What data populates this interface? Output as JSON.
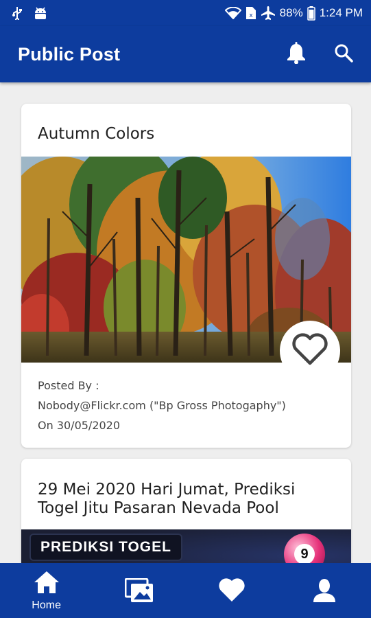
{
  "status_bar": {
    "battery": "88%",
    "time": "1:24 PM",
    "icons": [
      "usb-icon",
      "android-icon",
      "wifi-icon",
      "sim-icon",
      "airplane-icon",
      "battery-icon"
    ]
  },
  "app_bar": {
    "title": "Public Post",
    "actions": [
      "bell-icon",
      "search-icon"
    ]
  },
  "posts": [
    {
      "title": "Autumn Colors",
      "posted_by_label": "Posted By :",
      "author": "Nobody@Flickr.com (\"Bp Gross Photogaphy\")",
      "date_line": "On 30/05/2020"
    },
    {
      "title": "29 Mei 2020 Hari Jumat, Prediksi Togel Jitu Pasaran Nevada Pool",
      "image_banner": "PREDIKSI TOGEL",
      "ball_number": "9"
    }
  ],
  "bottom_nav": {
    "items": [
      {
        "label": "Home",
        "icon": "home-icon",
        "active": true
      },
      {
        "icon": "gallery-icon"
      },
      {
        "icon": "heart-icon"
      },
      {
        "icon": "profile-icon"
      }
    ]
  },
  "colors": {
    "primary": "#0d3c9e",
    "background": "#eeeeee"
  }
}
